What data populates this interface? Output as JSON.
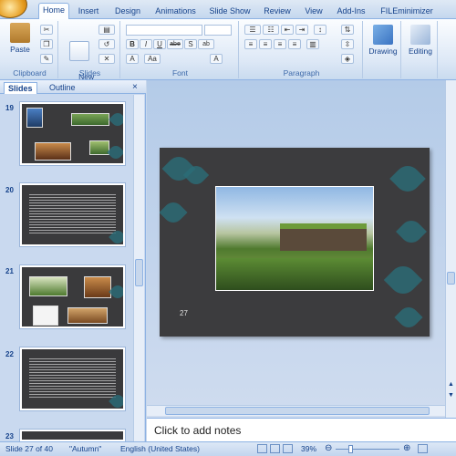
{
  "tabs": [
    "Home",
    "Insert",
    "Design",
    "Animations",
    "Slide Show",
    "Review",
    "View",
    "Add-Ins",
    "FILEminimizer"
  ],
  "ribbon": {
    "paste_label": "Paste",
    "new_slide_label": "New\nSlide",
    "groups": {
      "clipboard": "Clipboard",
      "slides": "Slides",
      "font": "Font",
      "paragraph": "Paragraph"
    },
    "drawing_label": "Drawing",
    "editing_label": "Editing",
    "font_buttons": [
      "B",
      "I",
      "U",
      "abe",
      "S",
      "ab",
      "A",
      "Aa",
      "A"
    ]
  },
  "pane": {
    "tabs": [
      "Slides",
      "Outline"
    ],
    "close": "×",
    "thumb_numbers": [
      "19",
      "20",
      "21",
      "22",
      "23"
    ]
  },
  "slide": {
    "number": "27"
  },
  "notes": {
    "placeholder": "Click to add notes"
  },
  "status": {
    "slide_info": "Slide 27 of 40",
    "theme": "\"Autumn\"",
    "language": "English (United States)",
    "zoom": "39%"
  }
}
